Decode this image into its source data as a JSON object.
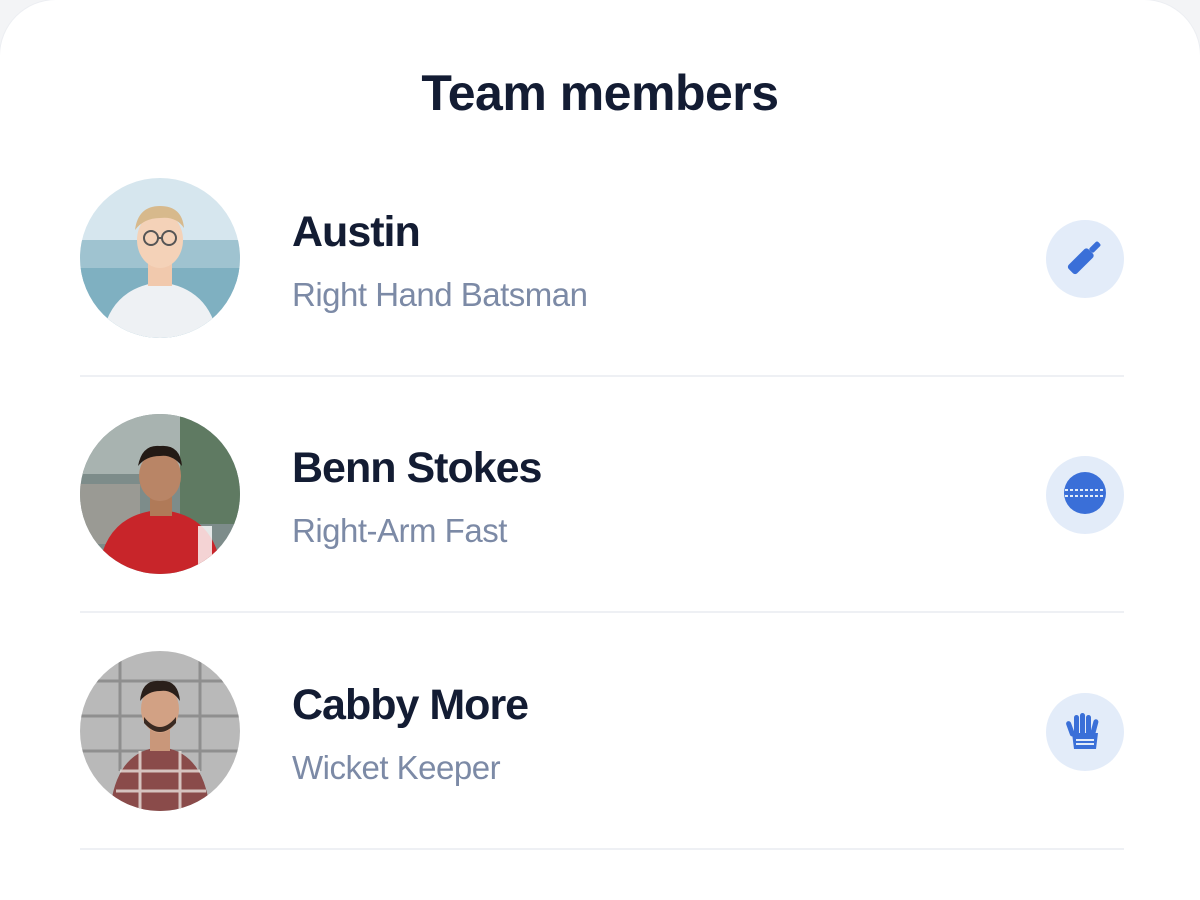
{
  "header": {
    "title": "Team members"
  },
  "members": [
    {
      "name": "Austin",
      "role": "Right Hand Batsman",
      "role_icon": "cricket-bat-icon"
    },
    {
      "name": "Benn Stokes",
      "role": "Right-Arm Fast",
      "role_icon": "cricket-ball-icon"
    },
    {
      "name": "Cabby More",
      "role": "Wicket Keeper",
      "role_icon": "keeper-gloves-icon"
    }
  ],
  "colors": {
    "heading": "#131c33",
    "subtext": "#7c8aa6",
    "accent": "#3a6fd8",
    "badge_bg": "#e3ecf9",
    "divider": "#eef0f4"
  }
}
